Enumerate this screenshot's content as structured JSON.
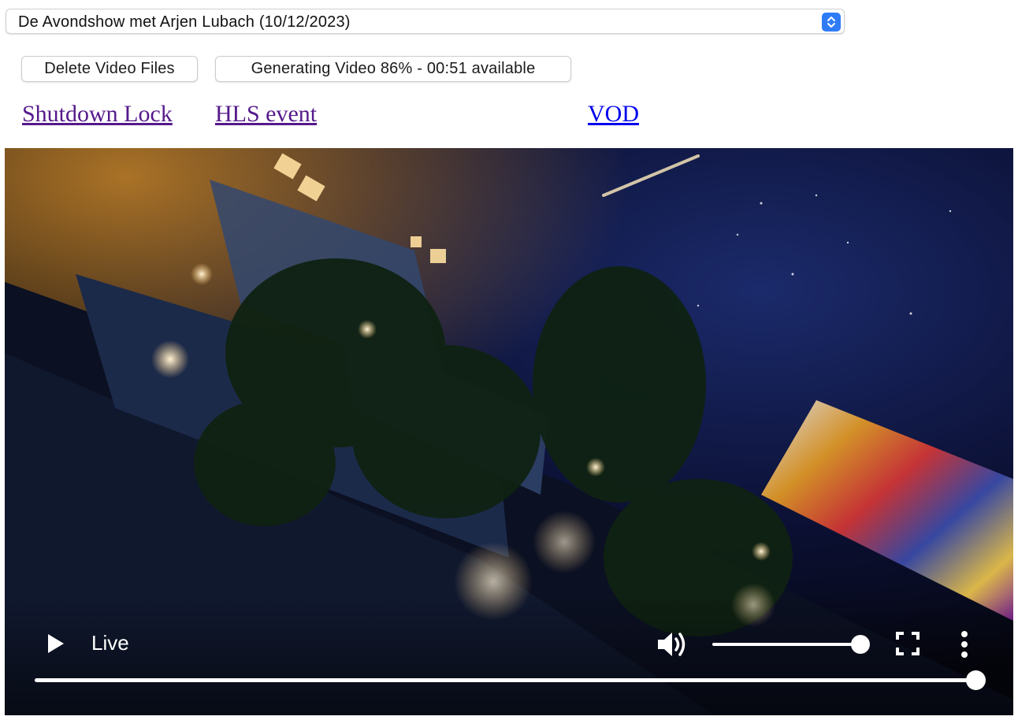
{
  "program_select": {
    "selected": "De Avondshow met Arjen Lubach (10/12/2023)"
  },
  "buttons": {
    "delete_label": "Delete Video Files",
    "generate_label": "Generating Video 86% - 00:51 available"
  },
  "links": {
    "shutdown_lock": "Shutdown Lock",
    "hls_event": "HLS event",
    "vod": "VOD"
  },
  "player": {
    "live_label": "Live",
    "volume_level": 1.0,
    "seek_position": 1.0,
    "icons": [
      "play-icon",
      "volume-icon",
      "fullscreen-icon",
      "more-options-icon"
    ]
  },
  "colors": {
    "select_accent": "#2f7cf6",
    "visited_link": "#551a8b",
    "unvisited_link": "#0000ee"
  }
}
